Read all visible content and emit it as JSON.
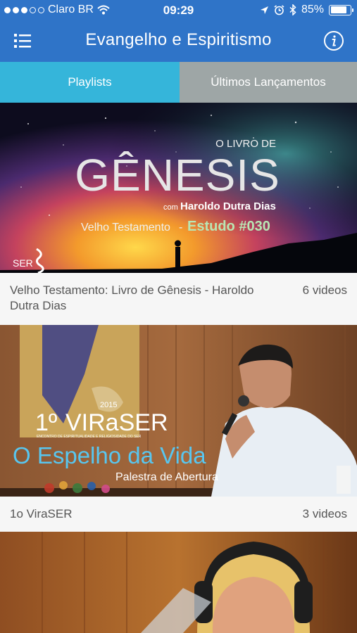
{
  "status_bar": {
    "carrier": "Claro BR",
    "time": "09:29",
    "battery": "85%",
    "battery_level": 0.85
  },
  "nav": {
    "title": "Evangelho e Espiritismo",
    "menu_icon": "list-menu-icon",
    "info_icon": "info-icon"
  },
  "tabs": [
    {
      "label": "Playlists",
      "active": true
    },
    {
      "label": "Últimos Lançamentos",
      "active": false
    }
  ],
  "playlists": [
    {
      "title": "Velho Testamento: Livro de Gênesis - Haroldo Dutra Dias",
      "count": "6 videos",
      "thumb": {
        "kicker": "O LIVRO DE",
        "headline": "GÊNESIS",
        "byline_prefix": "com",
        "byline_name": "Haroldo Dutra Dias",
        "series": "Velho Testamento",
        "series_sep": "-",
        "study": "Estudo #030",
        "logo": "SER"
      }
    },
    {
      "title": "1o ViraSER",
      "count": "3 videos",
      "thumb": {
        "event_number": "1º",
        "event_name": "VIRaSER",
        "year": "2015",
        "tagline": "ENCONTRO DE ESPIRITUALIDADE E RELIGIOSIDADE DO SER",
        "headline": "O Espelho da Vida",
        "subtitle": "Palestra de Abertura"
      }
    }
  ]
}
